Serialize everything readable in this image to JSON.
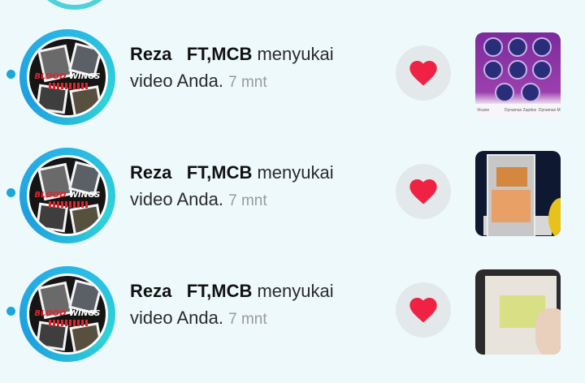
{
  "notifications": [
    {
      "user": "Reza   FT,MCB",
      "action": " menyukai video Anda. ",
      "time": "7 mnt",
      "avatar_text": {
        "red": "BLOOD",
        "white": "WINGS"
      }
    },
    {
      "user": "Reza   FT,MCB",
      "action": " menyukai video Anda. ",
      "time": "7 mnt",
      "avatar_text": {
        "red": "BLOOD",
        "white": "WINGS"
      }
    },
    {
      "user": "Reza   FT,MCB",
      "action": " menyukai video Anda. ",
      "time": "7 mnt",
      "avatar_text": {
        "red": "BLOOD",
        "white": "WINGS"
      }
    }
  ],
  "thumb1_labels": [
    "Vicane",
    "Dynamax Zapdos",
    "Dynamax M"
  ],
  "icons": {
    "like": "heart-icon"
  },
  "colors": {
    "heart": "#ef2244",
    "unread": "#1aa7d9",
    "ring": "#28b6e6",
    "background": "#eef9fb"
  }
}
